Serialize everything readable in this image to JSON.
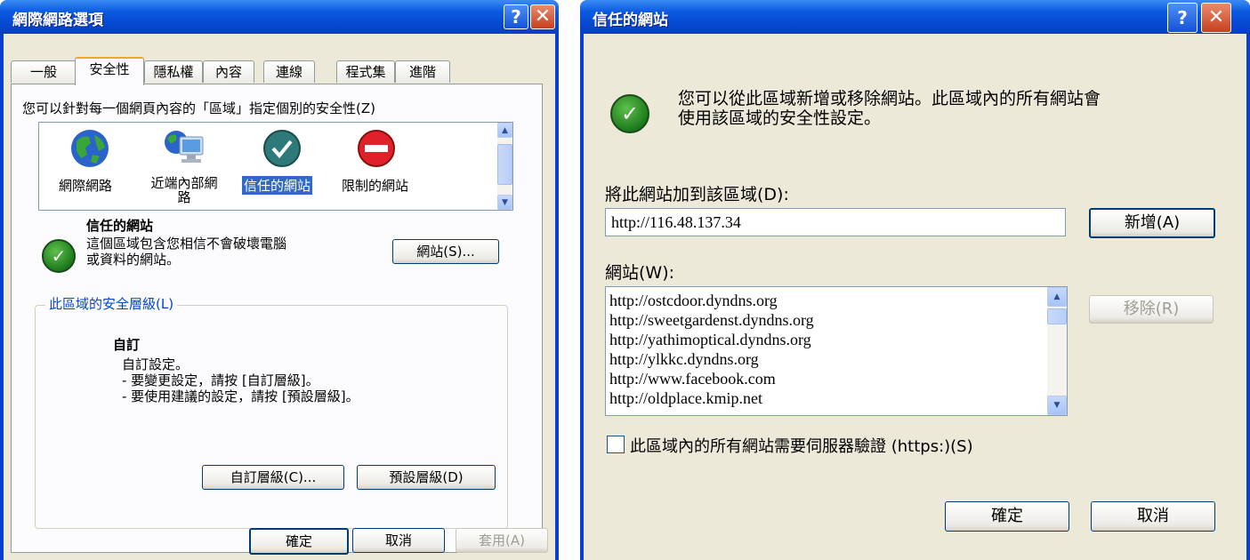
{
  "left_window": {
    "title": "網際網路選項",
    "help_btn": "?",
    "close_btn": "✕",
    "tabs": [
      "一般",
      "安全性",
      "隱私權",
      "內容",
      "連線",
      "程式集",
      "進階"
    ],
    "instruction": "您可以針對每一個網頁內容的「區域」指定個別的安全性(Z)",
    "zones": [
      {
        "label": "網際網路",
        "icon": "globe-icon"
      },
      {
        "label": "近端內部網\n路",
        "icon": "local-intranet-icon"
      },
      {
        "label": "信任的網站",
        "icon": "trusted-sites-icon"
      },
      {
        "label": "限制的網站",
        "icon": "restricted-sites-icon"
      }
    ],
    "zone_title": "信任的網站",
    "zone_desc_1": "這個區域包含您相信不會破壞電腦",
    "zone_desc_2": "或資料的網站。",
    "sites_button": "網站(S)...",
    "security_level_legend": "此區域的安全層級(L)",
    "custom_title": "自訂",
    "custom_line1": "自訂設定。",
    "custom_line2": "- 要變更設定，請按 [自訂層級]。",
    "custom_line3": "- 要使用建議的設定，請按 [預設層級]。",
    "custom_level_button": "自訂層級(C)...",
    "default_level_button": "預設層級(D)",
    "ok_button": "確定",
    "cancel_button": "取消",
    "apply_button": "套用(A)"
  },
  "right_window": {
    "title": "信任的網站",
    "help_btn": "?",
    "close_btn": "✕",
    "info_line1": "您可以從此區域新增或移除網站。此區域內的所有網站會",
    "info_line2": "使用該區域的安全性設定。",
    "add_label": "將此網站加到該區域(D):",
    "add_input_value": "http://116.48.137.34",
    "add_button": "新增(A)",
    "websites_label": "網站(W):",
    "websites": [
      "http://ostcdoor.dyndns.org",
      "http://sweetgardenst.dyndns.org",
      "http://yathimoptical.dyndns.org",
      "http://ylkkc.dyndns.org",
      "http://www.facebook.com",
      "http://oldplace.kmip.net"
    ],
    "remove_button": "移除(R)",
    "https_checkbox_label": "此區域內的所有網站需要伺服器驗證 (https:)(S)",
    "ok_button": "確定",
    "cancel_button": "取消"
  }
}
